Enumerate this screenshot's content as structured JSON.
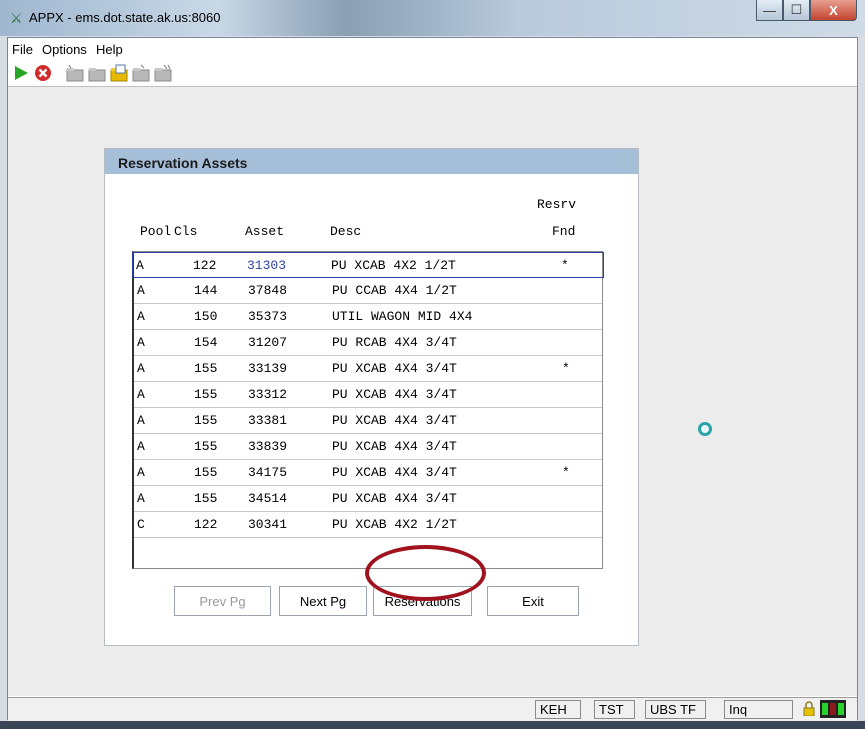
{
  "window": {
    "title": "APPX - ems.dot.state.ak.us:8060",
    "minimize_glyph": "—",
    "maximize_glyph": "☐",
    "close_glyph": "X"
  },
  "menu": {
    "file": "File",
    "options": "Options",
    "help": "Help"
  },
  "toolbar": {
    "icons": [
      "play-icon",
      "stop-icon",
      "folder-icon",
      "folder-icon",
      "folder-open-icon",
      "folder-icon",
      "folder-icon"
    ],
    "colors": {
      "play": "#2aa52a",
      "stop": "#d22b2b",
      "folder": "#b8b8b8",
      "folder_open": "#e6b800"
    }
  },
  "panel": {
    "title": "Reservation Assets",
    "headers": {
      "pool": "Pool",
      "cls": "Cls",
      "asset": "Asset",
      "desc": "Desc",
      "resrv": "Resrv",
      "fnd": "Fnd"
    },
    "rows": [
      {
        "pool": "A",
        "cls": "122",
        "asset": "31303",
        "desc": "PU XCAB 4X2 1/2T",
        "fnd": "*"
      },
      {
        "pool": "A",
        "cls": "144",
        "asset": "37848",
        "desc": "PU CCAB 4X4 1/2T",
        "fnd": ""
      },
      {
        "pool": "A",
        "cls": "150",
        "asset": "35373",
        "desc": "UTIL WAGON MID 4X4",
        "fnd": ""
      },
      {
        "pool": "A",
        "cls": "154",
        "asset": "31207",
        "desc": "PU RCAB 4X4 3/4T",
        "fnd": ""
      },
      {
        "pool": "A",
        "cls": "155",
        "asset": "33139",
        "desc": "PU XCAB 4X4 3/4T",
        "fnd": "*"
      },
      {
        "pool": "A",
        "cls": "155",
        "asset": "33312",
        "desc": "PU XCAB 4X4 3/4T",
        "fnd": ""
      },
      {
        "pool": "A",
        "cls": "155",
        "asset": "33381",
        "desc": "PU XCAB 4X4 3/4T",
        "fnd": ""
      },
      {
        "pool": "A",
        "cls": "155",
        "asset": "33839",
        "desc": "PU XCAB 4X4 3/4T",
        "fnd": ""
      },
      {
        "pool": "A",
        "cls": "155",
        "asset": "34175",
        "desc": "PU XCAB 4X4 3/4T",
        "fnd": "*"
      },
      {
        "pool": "A",
        "cls": "155",
        "asset": "34514",
        "desc": "PU XCAB 4X4 3/4T",
        "fnd": ""
      },
      {
        "pool": "C",
        "cls": "122",
        "asset": "30341",
        "desc": "PU XCAB 4X2 1/2T",
        "fnd": ""
      }
    ],
    "buttons": {
      "prev": "Prev Pg",
      "next": "Next Pg",
      "reservations": "Reservations",
      "exit": "Exit"
    }
  },
  "status": {
    "user": "KEH",
    "env": "TST",
    "app": "UBS TF",
    "mode": "Inq"
  },
  "colors": {
    "panel_header": "#a6bfd9",
    "annotation_circle": "#a0121d",
    "selected_row_border": "#2f3fa8"
  }
}
